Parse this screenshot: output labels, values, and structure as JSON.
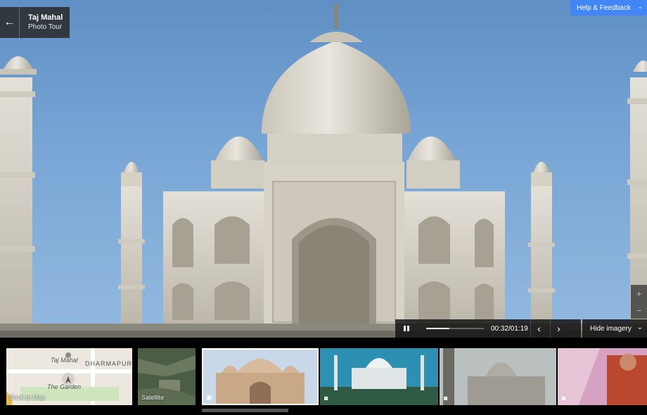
{
  "tour": {
    "title": "Taj Mahal",
    "subtitle": "Photo Tour"
  },
  "header": {
    "help_label": "Help & Feedback"
  },
  "player": {
    "time": "00:32/01:19",
    "progress": 0.4
  },
  "imagery": {
    "hide_label": "Hide imagery"
  },
  "zoom": {
    "in": "+",
    "out": "−"
  },
  "icons": {
    "back": "←",
    "chevron_down": "⌄",
    "prev": "‹",
    "next": "›"
  },
  "filmstrip": {
    "map": {
      "caption": "Back to Map",
      "labels": [
        "Taj Mahal",
        "DHARMAPUR",
        "The Garden"
      ]
    },
    "satellite": {
      "caption": "Satellite"
    },
    "photos": [
      {
        "icon": "video-icon",
        "selected": true
      },
      {
        "icon": "camera-icon",
        "selected": false
      },
      {
        "icon": "camera-icon",
        "selected": false
      },
      {
        "icon": "camera-icon",
        "selected": false
      }
    ]
  },
  "colors": {
    "accent": "#4285f4",
    "sky": "#79a6d6",
    "marble": "#d9d4c7"
  }
}
